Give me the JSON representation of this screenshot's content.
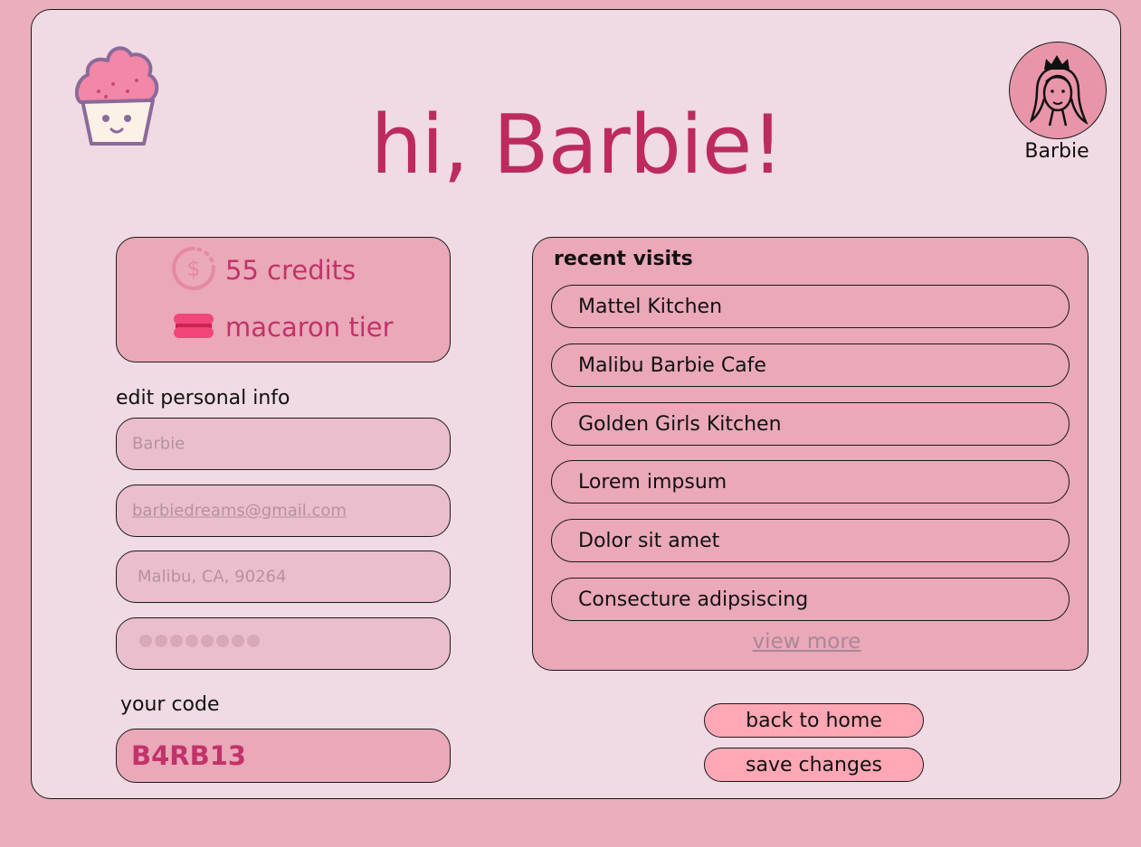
{
  "greeting": "hi, Barbie!",
  "profile": {
    "name": "Barbie",
    "avatar_icon": "barbie-avatar-icon"
  },
  "logo_icon": "cupcake-icon",
  "stats": {
    "credits_icon": "dollar-coin-icon",
    "credits": "55 credits",
    "tier_icon": "macaron-icon",
    "tier": "macaron tier"
  },
  "personal_info": {
    "label": "edit personal info",
    "name_value": "Barbie",
    "email_value": "barbiedreams@gmail.com",
    "address_value": "Malibu, CA, 90264",
    "password_masked_dots": 8
  },
  "code": {
    "label": "your code",
    "value": "B4RB13"
  },
  "recent_visits": {
    "title": "recent visits",
    "items": [
      "Mattel Kitchen",
      "Malibu Barbie Cafe",
      "Golden Girls Kitchen",
      "Lorem impsum",
      "Dolor sit amet",
      "Consecture adipsiscing"
    ],
    "view_more": "view more"
  },
  "actions": {
    "back_home": "back to home",
    "save": "save changes"
  },
  "colors": {
    "page_bg": "#ebaebd",
    "card_bg": "#f0dae3",
    "accent": "#bd2b5e",
    "panel": "#eaa8b9",
    "input_bg": "#ebbecd",
    "button": "#ffa7b5"
  }
}
